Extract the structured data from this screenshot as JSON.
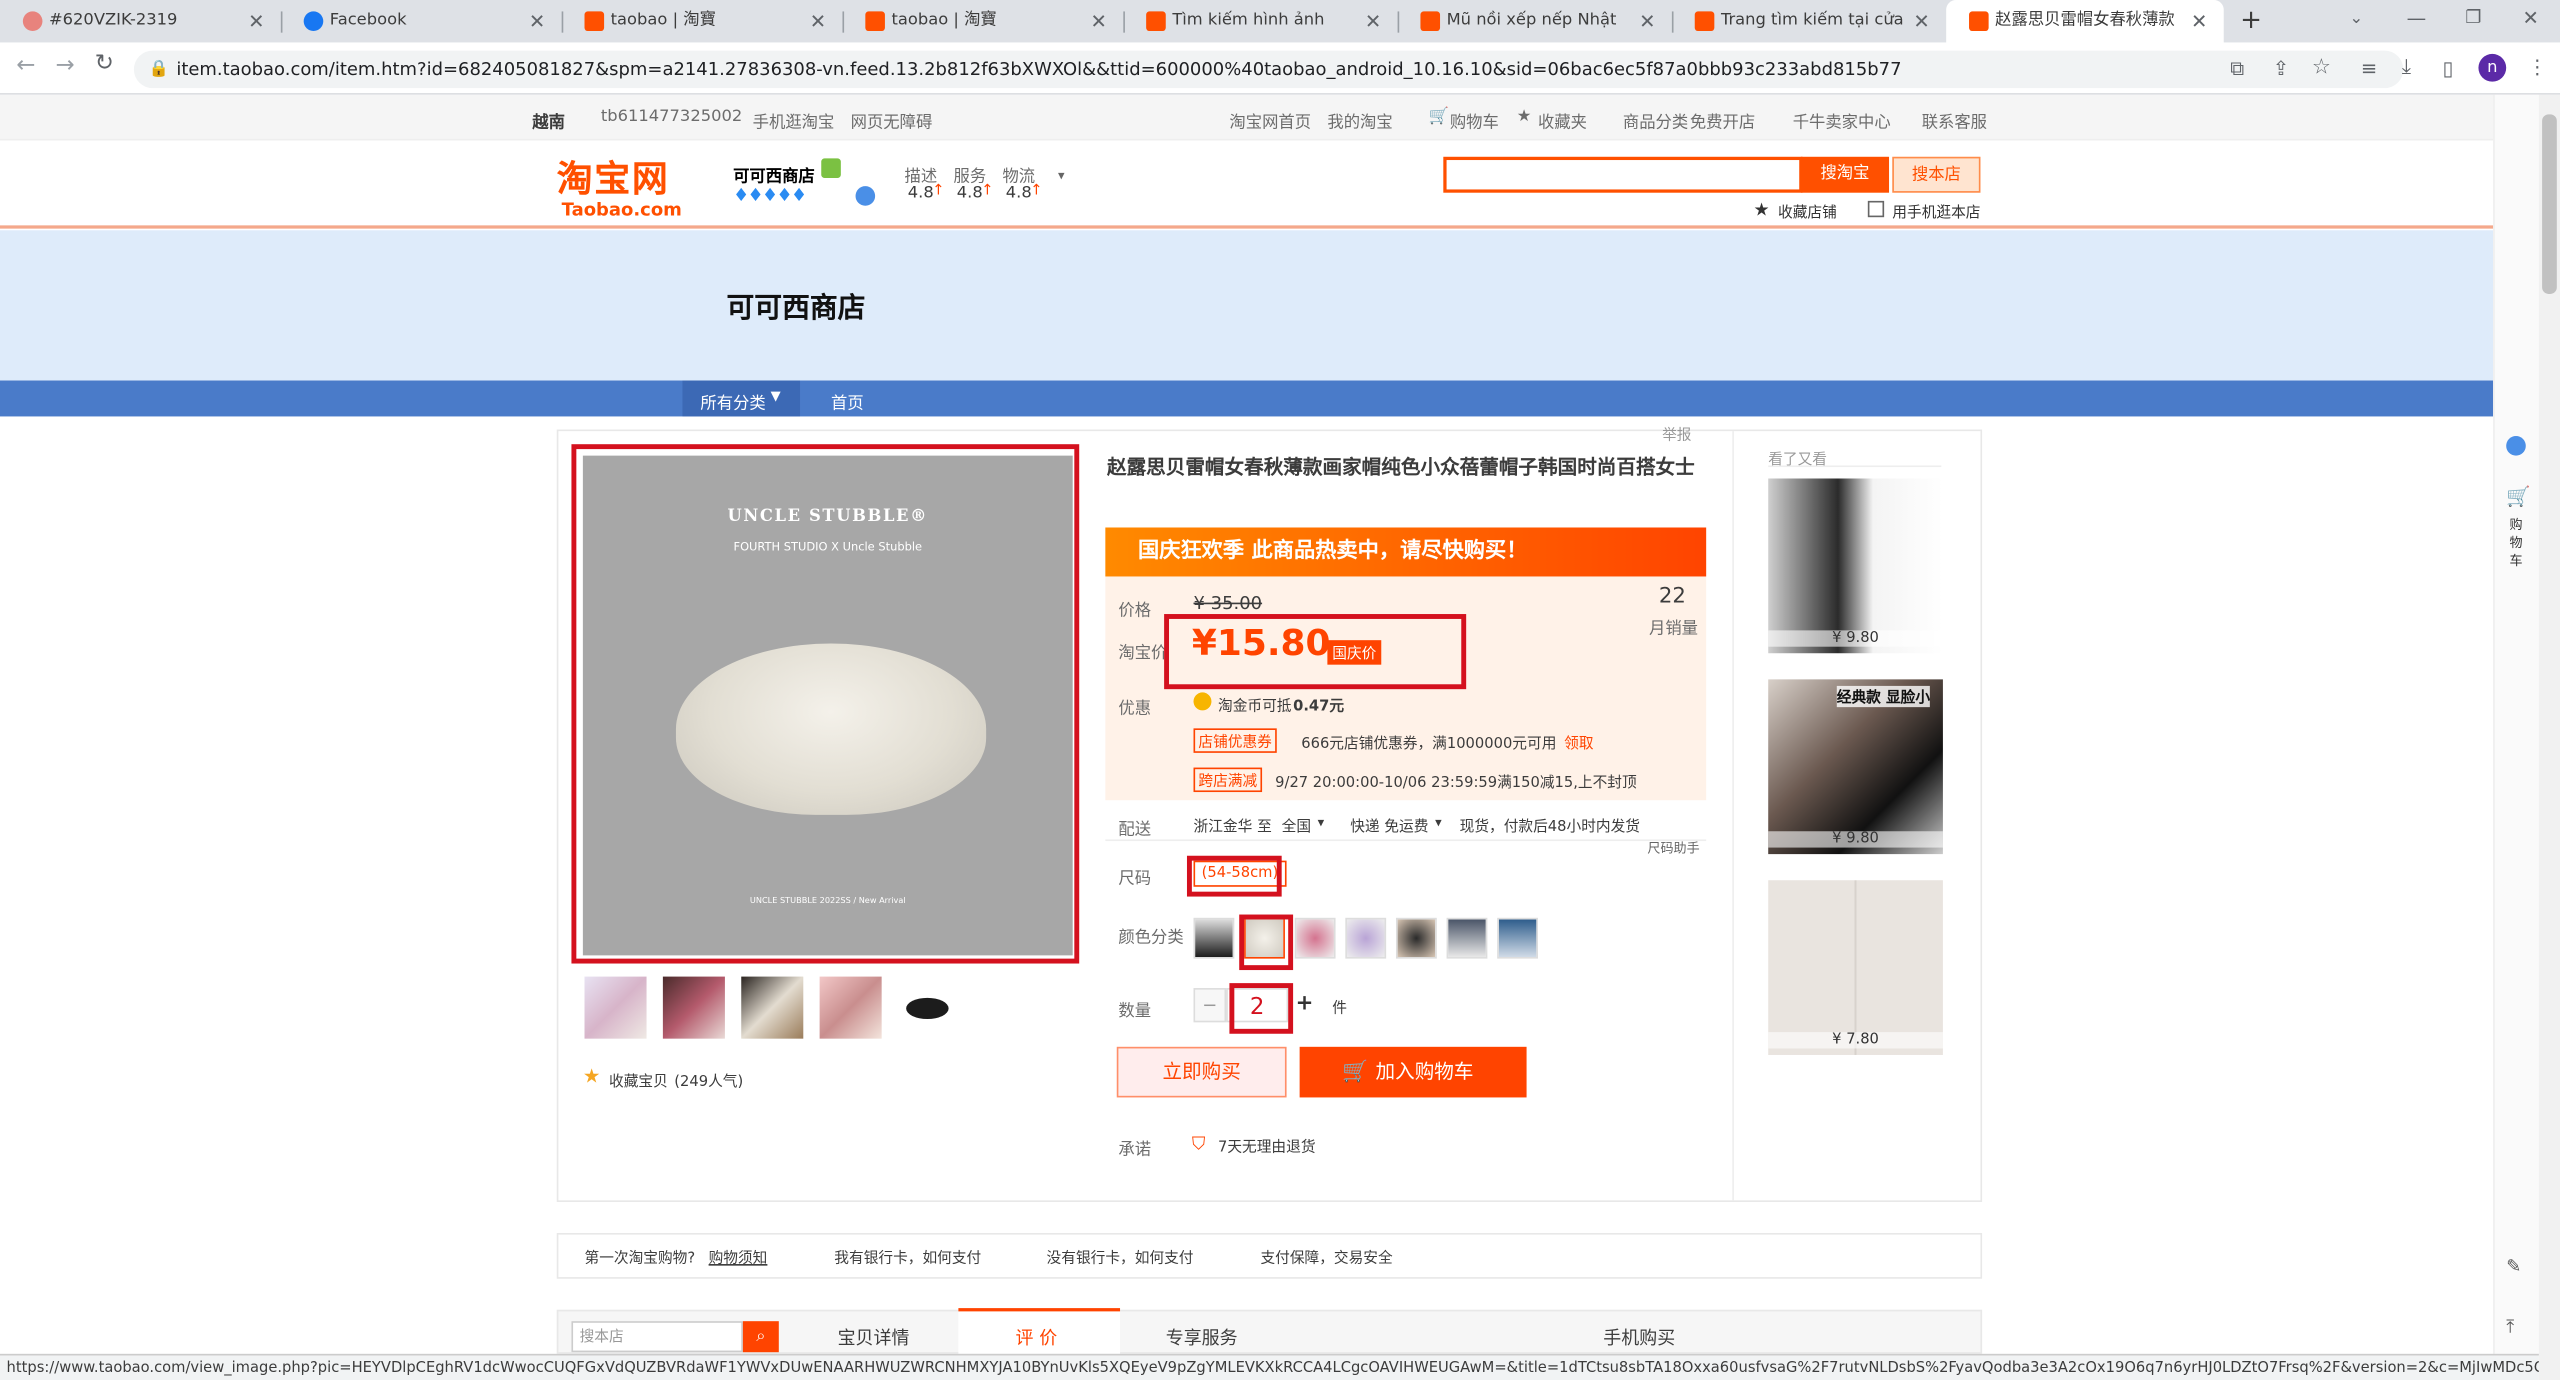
{
  "browser": {
    "tabs": [
      {
        "title": "#620VZIK-2319",
        "favicon_color": "#e8837d"
      },
      {
        "title": "Facebook",
        "favicon_color": "#1877f2"
      },
      {
        "title": "taobao | 淘寶",
        "favicon_color": "#ff5000"
      },
      {
        "title": "taobao | 淘寶",
        "favicon_color": "#ff5000"
      },
      {
        "title": "Tìm kiếm hình ảnh trên taob",
        "favicon_color": "#ff5000"
      },
      {
        "title": "Mũ nồi xếp nếp Nhật Bản dã",
        "favicon_color": "#ff5000"
      },
      {
        "title": "Trang tìm kiếm tại cửa hàng-",
        "favicon_color": "#ff5000"
      },
      {
        "title": "赵露思贝雷帽女春秋薄款画",
        "favicon_color": "#ff5000"
      }
    ],
    "new_tab": "+",
    "url": "item.taobao.com/item.htm?id=682405081827&spm=a2141.27836308-vn.feed.13.2b812f63bXWXOl&&ttid=600000%40taobao_android_10.16.10&sid=06bac6ec5f87a0bbb93c233abd815b77",
    "profile_initial": "n",
    "status_url": "https://www.taobao.com/view_image.php?pic=HEYVDlpCEghRV1dcWwocCUQFGxVdQUZBVRdaWF1YWVxDUwENAARHWUZWRCNHMXYJA10BYnUvKls5XQEyeV9pZgYMLEVKXkRCCA4LCgcOAVIHWEUGAwM=&title=1dTCtsu8sbTA18Oxxa60usfvsaG%2F7rutvNLDsbS%2FyavQodba3e3A2cOx19O6q7n6yrHJ0LDZtO7Frsq%2F&version=2&c=MjIwMDc5OTM2MjA1Mg%3D%3D&seller..."
  },
  "topnav": {
    "region": "越南",
    "user": "tb611477325002",
    "mobile": "手机逛淘宝",
    "accessible": "网页无障碍",
    "home": "淘宝网首页",
    "my": "我的淘宝",
    "cart": "购物车",
    "fav": "收藏夹",
    "category": "商品分类",
    "free": "免费开店",
    "seller": "千牛卖家中心",
    "service": "联系客服"
  },
  "header": {
    "logo_cn": "淘宝网",
    "logo_en": "Taobao.com",
    "shop_name": "可可西商店",
    "rating_labels": [
      "描述",
      "服务",
      "物流"
    ],
    "rating_values": [
      "4.8",
      "4.8",
      "4.8"
    ],
    "search_btn": "搜淘宝",
    "search_shop_btn": "搜本店",
    "fav_shop": "收藏店铺",
    "mobile_shop": "用手机逛本店"
  },
  "banner": {
    "shop_title": "可可西商店"
  },
  "shopnav": {
    "all": "所有分类",
    "home": "首页"
  },
  "product": {
    "report": "举报",
    "title": "赵露思贝雷帽女春秋薄款画家帽纯色小众蓓蕾帽子韩国时尚百搭女士",
    "promo": "国庆狂欢季  此商品热卖中，请尽快购买！",
    "price_label": "价格",
    "orig_price": "¥ 35.00",
    "sales_count": "22",
    "sales_label": "月销量",
    "tb_price_label": "淘宝价",
    "tb_price": "¥15.80",
    "tb_tag": "国庆价",
    "discount_label": "优惠",
    "coin_text": "淘金币可抵",
    "coin_value": "0.47元",
    "coupon_tag": "店铺优惠券",
    "coupon_text": "666元店铺优惠券，满1000000元可用",
    "coupon_get": "领取",
    "cross_tag": "跨店满减",
    "cross_text": "9/27 20:00:00-10/06 23:59:59满150减15,上不封顶",
    "ship_label": "配送",
    "ship_from": "浙江金华",
    "ship_to_word": "至",
    "ship_to": "全国",
    "ship_method": "快递 免运费",
    "ship_time": "现货，付款后48小时内发货",
    "size_helper": "尺码助手",
    "size_label": "尺码",
    "size_value": "(54-58cm)",
    "color_label": "颜色分类",
    "qty_label": "数量",
    "qty_minus": "−",
    "qty_value": "2",
    "qty_plus": "+",
    "qty_unit": "件",
    "buy_now": "立即购买",
    "add_cart": "加入购物车",
    "promise_label": "承诺",
    "promise_text": "7天无理由退货",
    "fav_item": "收藏宝贝",
    "fav_count": "(249人气)",
    "image_brand": "UNCLE STUBBLE®",
    "image_sub": "FOURTH STUDIO  X  Uncle Stubble",
    "image_foot": "UNCLE STUBBLE 2022SS / New Arrival"
  },
  "related": {
    "title": "看了又看",
    "prices": [
      "¥ 9.80",
      "¥ 9.80",
      "¥ 7.80"
    ],
    "badge": "经典款 显脸小"
  },
  "rail": {
    "cart": "购物车"
  },
  "help": {
    "first": "第一次淘宝购物?",
    "guide": "购物须知",
    "q1": "我有银行卡，如何支付",
    "q2": "没有银行卡，如何支付",
    "q3": "支付保障，交易安全"
  },
  "bottomtabs": {
    "search_placeholder": "搜本店",
    "detail": "宝贝详情",
    "review": "评 价",
    "service": "专享服务",
    "mobile_buy": "手机购买"
  }
}
